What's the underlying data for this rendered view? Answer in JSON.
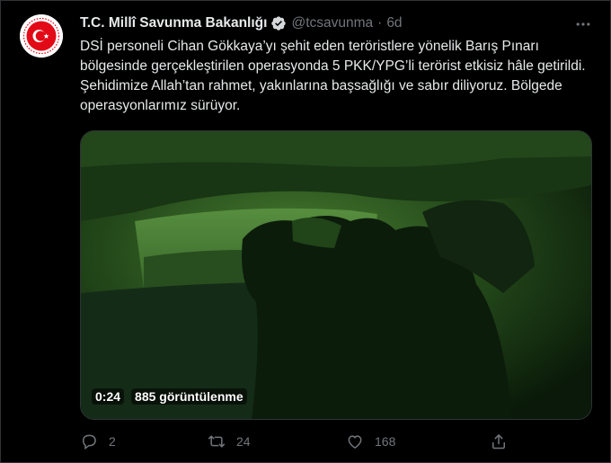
{
  "tweet": {
    "display_name": "T.C. Millî Savunma Bakanlığı",
    "handle": "@tcsavunma",
    "separator": "·",
    "time": "6d",
    "text": "DSİ personeli Cihan Gökkaya’yı şehit eden teröristlere yönelik Barış Pınarı bölgesinde gerçekleştirilen operasyonda 5 PKK/YPG’li terörist etkisiz hâle getirildi. Şehidimize Allah’tan rahmet, yakınlarına başsağlığı ve sabır diliyoruz. Bölgede operasyonlarımız sürüyor."
  },
  "media": {
    "duration": "0:24",
    "views": "885 görüntülenme"
  },
  "actions": {
    "replies": "2",
    "retweets": "24",
    "likes": "168"
  },
  "icons": {
    "avatar": "ministry-emblem-icon",
    "verified": "verified-badge-icon",
    "more": "more-options-icon",
    "reply": "reply-icon",
    "retweet": "retweet-icon",
    "like": "heart-icon",
    "share": "share-icon"
  },
  "colors": {
    "background": "#000000",
    "text": "#e7e9ea",
    "secondary_text": "#71767b",
    "border": "#2f3336",
    "emblem_red": "#e30a17",
    "video_green": "#3a6b2a"
  }
}
